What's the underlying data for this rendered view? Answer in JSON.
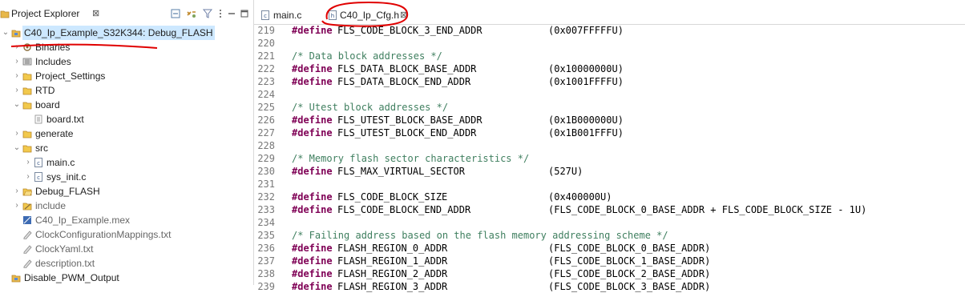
{
  "explorer": {
    "title": "Project Explorer",
    "close": "⊠",
    "tree": [
      {
        "label": "C40_Ip_Example_S32K344: Debug_FLASH",
        "arrow": "⌄",
        "icon": "project-icon",
        "indent": 0,
        "selected": true
      },
      {
        "label": "Binaries",
        "arrow": "›",
        "icon": "binaries-icon",
        "indent": 1
      },
      {
        "label": "Includes",
        "arrow": "›",
        "icon": "includes-icon",
        "indent": 1
      },
      {
        "label": "Project_Settings",
        "arrow": "›",
        "icon": "folder-icon",
        "indent": 1
      },
      {
        "label": "RTD",
        "arrow": "›",
        "icon": "folder-icon",
        "indent": 1
      },
      {
        "label": "board",
        "arrow": "⌄",
        "icon": "folder-icon",
        "indent": 1
      },
      {
        "label": "board.txt",
        "arrow": "",
        "icon": "text-file-icon",
        "indent": 2
      },
      {
        "label": "generate",
        "arrow": "›",
        "icon": "folder-icon",
        "indent": 1
      },
      {
        "label": "src",
        "arrow": "⌄",
        "icon": "folder-icon",
        "indent": 1
      },
      {
        "label": "main.c",
        "arrow": "›",
        "icon": "c-file-icon",
        "indent": 2
      },
      {
        "label": "sys_init.c",
        "arrow": "›",
        "icon": "c-file-icon",
        "indent": 2
      },
      {
        "label": "Debug_FLASH",
        "arrow": "›",
        "icon": "output-folder-icon",
        "indent": 1
      },
      {
        "label": "include",
        "arrow": "›",
        "icon": "include-folder-icon",
        "indent": 1,
        "gray": true
      },
      {
        "label": "C40_Ip_Example.mex",
        "arrow": "",
        "icon": "mex-file-icon",
        "indent": 1,
        "gray": true
      },
      {
        "label": "ClockConfigurationMappings.txt",
        "arrow": "",
        "icon": "doc-file-icon",
        "indent": 1,
        "gray": true
      },
      {
        "label": "ClockYaml.txt",
        "arrow": "",
        "icon": "doc-file-icon",
        "indent": 1,
        "gray": true
      },
      {
        "label": "description.txt",
        "arrow": "",
        "icon": "doc-file-icon",
        "indent": 1,
        "gray": true
      },
      {
        "label": "Disable_PWM_Output",
        "arrow": "",
        "icon": "project-icon",
        "indent": 0
      }
    ]
  },
  "editor": {
    "tabs": [
      {
        "label": "main.c",
        "icon": "c-file-icon"
      },
      {
        "label": "C40_Ip_Cfg.h",
        "icon": "h-file-icon",
        "close": "⊠",
        "active": true
      }
    ],
    "lines": [
      {
        "n": "219",
        "kw": "#define",
        "macro": "FLS_CODE_BLOCK_3_END_ADDR",
        "value": "(0x007FFFFFU)"
      },
      {
        "n": "220"
      },
      {
        "n": "221",
        "comment": "/* Data block addresses */"
      },
      {
        "n": "222",
        "kw": "#define",
        "macro": "FLS_DATA_BLOCK_BASE_ADDR",
        "value": "(0x10000000U)"
      },
      {
        "n": "223",
        "kw": "#define",
        "macro": "FLS_DATA_BLOCK_END_ADDR",
        "value": "(0x1001FFFFU)"
      },
      {
        "n": "224"
      },
      {
        "n": "225",
        "comment": "/* Utest block addresses */"
      },
      {
        "n": "226",
        "kw": "#define",
        "macro": "FLS_UTEST_BLOCK_BASE_ADDR",
        "value": "(0x1B000000U)"
      },
      {
        "n": "227",
        "kw": "#define",
        "macro": "FLS_UTEST_BLOCK_END_ADDR",
        "value": "(0x1B001FFFU)"
      },
      {
        "n": "228"
      },
      {
        "n": "229",
        "comment": "/* Memory flash sector characteristics */"
      },
      {
        "n": "230",
        "kw": "#define",
        "macro": "FLS_MAX_VIRTUAL_SECTOR",
        "value": "(527U)"
      },
      {
        "n": "231"
      },
      {
        "n": "232",
        "kw": "#define",
        "macro": "FLS_CODE_BLOCK_SIZE",
        "value": "(0x400000U)"
      },
      {
        "n": "233",
        "kw": "#define",
        "macro": "FLS_CODE_BLOCK_END_ADDR",
        "value": "(FLS_CODE_BLOCK_0_BASE_ADDR + FLS_CODE_BLOCK_SIZE - 1U)"
      },
      {
        "n": "234"
      },
      {
        "n": "235",
        "comment": "/* Failing address based on the flash memory addressing scheme */"
      },
      {
        "n": "236",
        "kw": "#define",
        "macro": "FLASH_REGION_0_ADDR",
        "value": "(FLS_CODE_BLOCK_0_BASE_ADDR)"
      },
      {
        "n": "237",
        "kw": "#define",
        "macro": "FLASH_REGION_1_ADDR",
        "value": "(FLS_CODE_BLOCK_1_BASE_ADDR)"
      },
      {
        "n": "238",
        "kw": "#define",
        "macro": "FLASH_REGION_2_ADDR",
        "value": "(FLS_CODE_BLOCK_2_BASE_ADDR)"
      },
      {
        "n": "239",
        "kw": "#define",
        "macro": "FLASH_REGION_3_ADDR",
        "value": "(FLS_CODE_BLOCK_3_BASE_ADDR)"
      }
    ]
  },
  "colors": {
    "keyword": "#7f0055",
    "comment": "#3f7f5f",
    "selection": "#cde8ff",
    "annotation": "#e00000"
  }
}
